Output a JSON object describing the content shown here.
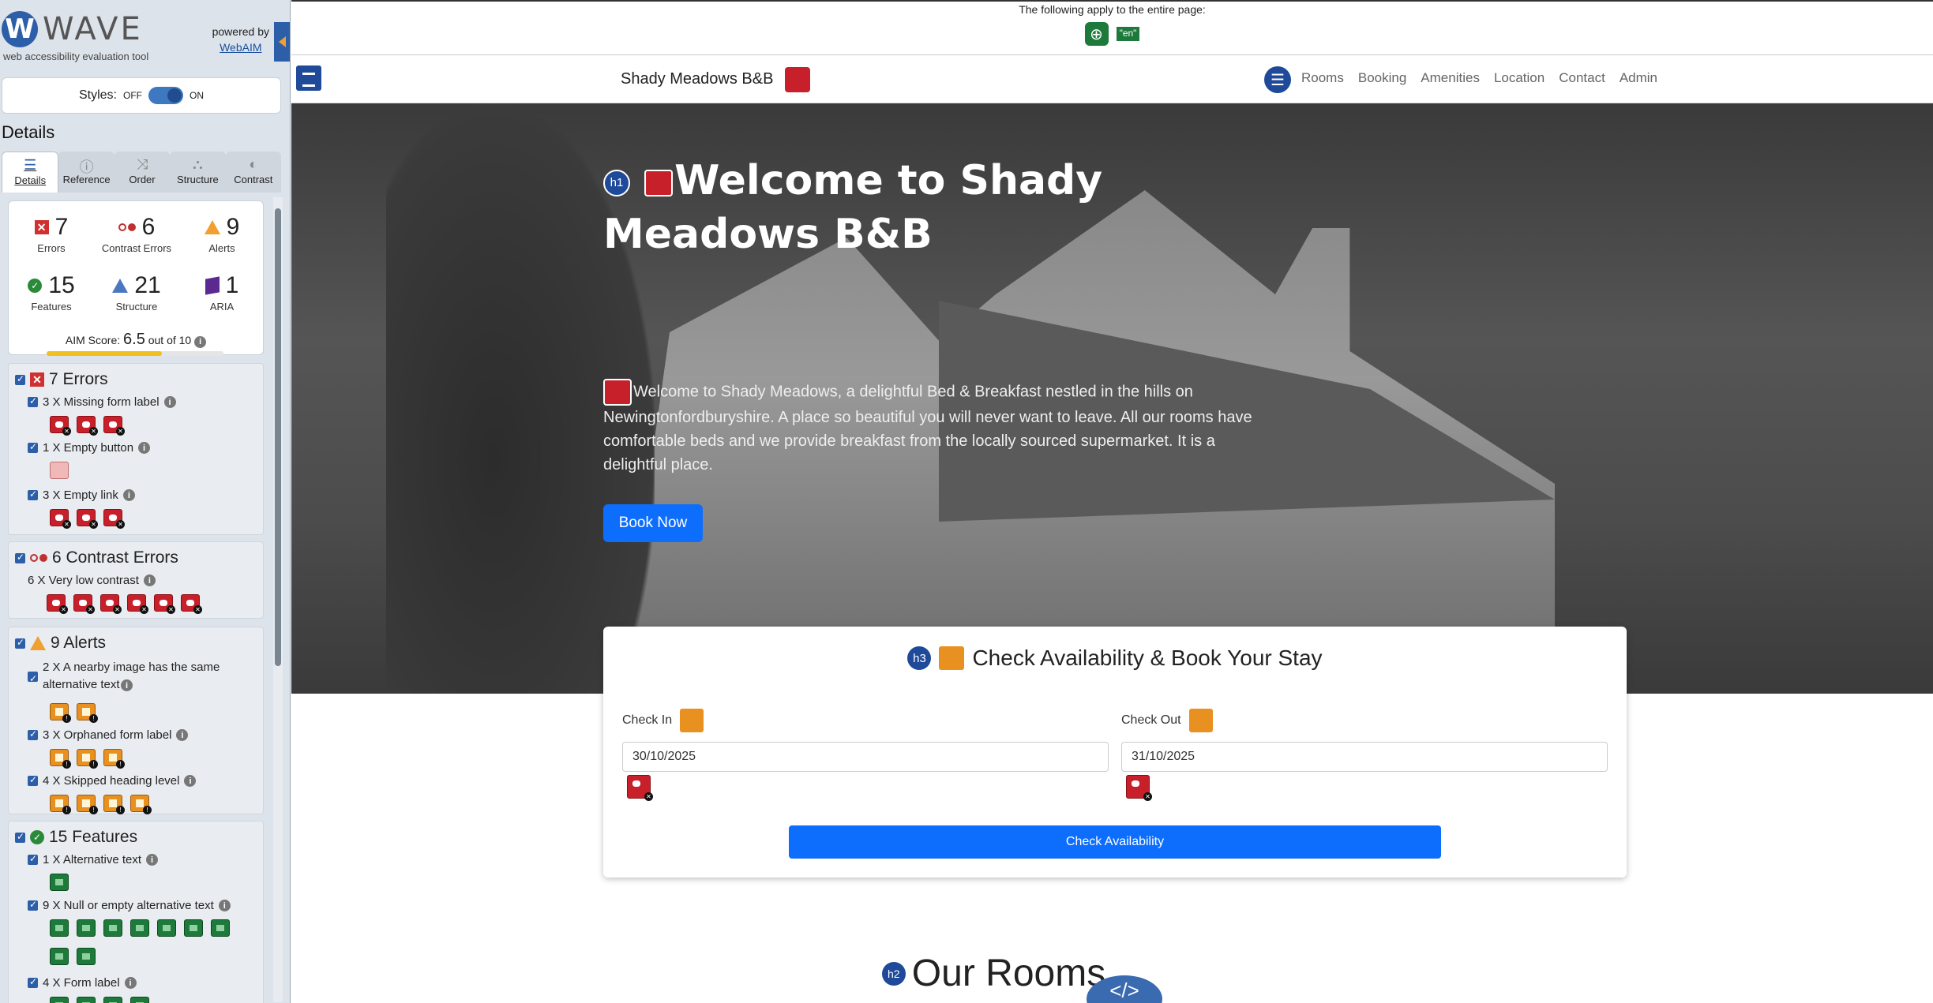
{
  "wave": {
    "logo_letter": "W",
    "logo_word": "WAVE",
    "subtitle": "web accessibility evaluation tool",
    "powered_by": "powered by",
    "powered_link": "WebAIM",
    "styles_label": "Styles:",
    "styles_off": "OFF",
    "styles_on": "ON",
    "details_heading": "Details",
    "tabs": [
      {
        "label": "Details",
        "icon": "list-icon"
      },
      {
        "label": "Reference",
        "icon": "info-icon"
      },
      {
        "label": "Order",
        "icon": "order-icon"
      },
      {
        "label": "Structure",
        "icon": "structure-icon"
      },
      {
        "label": "Contrast",
        "icon": "contrast-icon"
      }
    ],
    "summary": {
      "errors": {
        "count": "7",
        "label": "Errors"
      },
      "contrast": {
        "count": "6",
        "label": "Contrast Errors"
      },
      "alerts": {
        "count": "9",
        "label": "Alerts"
      },
      "features": {
        "count": "15",
        "label": "Features"
      },
      "structure": {
        "count": "21",
        "label": "Structure"
      },
      "aria": {
        "count": "1",
        "label": "ARIA"
      },
      "aim_label": "AIM Score:",
      "aim_score": "6.5",
      "aim_suffix": "out of 10",
      "aim_fraction": 0.65
    },
    "sections": {
      "errors": {
        "heading": "7 Errors",
        "items": [
          {
            "label": "3 X Missing form label"
          },
          {
            "label": "1 X Empty button"
          },
          {
            "label": "3 X Empty link"
          }
        ]
      },
      "contrast": {
        "heading": "6 Contrast Errors",
        "items": [
          {
            "label": "6 X Very low contrast"
          }
        ]
      },
      "alerts": {
        "heading": "9 Alerts",
        "items": [
          {
            "label": "2 X A nearby image has the same alternative text"
          },
          {
            "label": "3 X Orphaned form label"
          },
          {
            "label": "4 X Skipped heading level"
          }
        ]
      },
      "features": {
        "heading": "15 Features",
        "items": [
          {
            "label": "1 X Alternative text"
          },
          {
            "label": "9 X Null or empty alternative text"
          },
          {
            "label": "4 X Form label"
          }
        ]
      }
    }
  },
  "page": {
    "apply_text": "The following apply to the entire page:",
    "lang_badge": "\"en\"",
    "brand": "Shady Meadows B&B",
    "nav_links": [
      "Rooms",
      "Booking",
      "Amenities",
      "Location",
      "Contact",
      "Admin"
    ],
    "hero_title": "Welcome to Shady Meadows B&B",
    "hero_text": "Welcome to Shady Meadows, a delightful Bed & Breakfast nestled in the hills on Newingtonfordburyshire. A place so beautiful you will never want to leave. All our rooms have comfortable beds and we provide breakfast from the locally sourced supermarket. It is a delightful place.",
    "book_now": "Book Now",
    "card_title": "Check Availability & Book Your Stay",
    "check_in_label": "Check In",
    "check_in_value": "30/10/2025",
    "check_out_label": "Check Out",
    "check_out_value": "31/10/2025",
    "check_button": "Check Availability",
    "rooms_heading": "Our Rooms",
    "h1_badge": "h1",
    "h2_badge": "h2",
    "h3_badge": "h3",
    "code_toggle": "</>"
  }
}
